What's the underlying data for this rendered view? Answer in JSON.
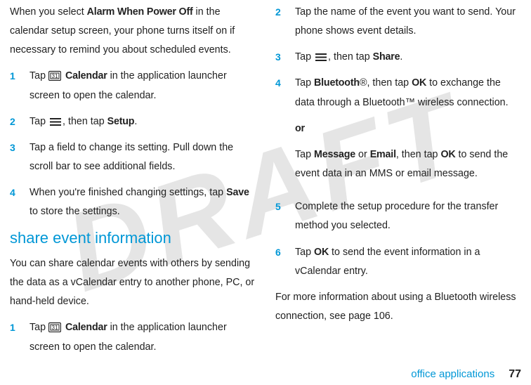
{
  "watermark": "DRAFT",
  "left": {
    "intro_pre": "When you select ",
    "intro_bold": "Alarm When Power Off",
    "intro_post": " in the calendar setup screen, your phone turns itself on if necessary to remind you about scheduled events.",
    "steps": [
      {
        "num": "1",
        "pre": "Tap ",
        "icon": "calendar",
        "bold1": "Calendar",
        "mid": " in the application launcher screen to open the calendar."
      },
      {
        "num": "2",
        "pre": "Tap ",
        "icon": "menu",
        "mid": ", then tap ",
        "bold1": "Setup",
        "post": "."
      },
      {
        "num": "3",
        "text": "Tap a field to change its setting. Pull down the scroll bar to see additional fields."
      },
      {
        "num": "4",
        "pre": "When you're finished changing settings, tap ",
        "bold1": "Save",
        "post": " to store the settings."
      }
    ],
    "heading": "share event information",
    "share_para": "You can share calendar events with others by sending the data as a vCalendar entry to another phone, PC, or hand-held device.",
    "share_step": {
      "num": "1",
      "pre": "Tap ",
      "icon": "calendar",
      "bold1": "Calendar",
      "mid": " in the application launcher screen to open the calendar."
    }
  },
  "right": {
    "steps": [
      {
        "num": "2",
        "text": "Tap the name of the event you want to send. Your phone shows event details."
      },
      {
        "num": "3",
        "pre": "Tap ",
        "icon": "menu",
        "mid": ", then tap ",
        "bold1": "Share",
        "post": "."
      },
      {
        "num": "4",
        "pre": "Tap ",
        "bold1": "Bluetooth",
        "sym1": "®",
        "mid1": ", then tap ",
        "bold2": "OK",
        "mid2": " to exchange the data through a Bluetooth™ wireless connection.",
        "or": "or",
        "pre2": "Tap ",
        "bold3": "Message",
        "mid3": " or ",
        "bold4": "Email",
        "mid4": ", then tap ",
        "bold5": "OK",
        "post2": " to send the event data in an MMS or email message."
      },
      {
        "num": "5",
        "text": "Complete the setup procedure for the transfer method you selected."
      },
      {
        "num": "6",
        "pre": "Tap ",
        "bold1": "OK",
        "post": " to send the event information in a vCalendar entry."
      }
    ],
    "closing": "For more information about using a Bluetooth wireless connection, see page 106."
  },
  "footer": {
    "label": "office applications",
    "page": "77"
  }
}
